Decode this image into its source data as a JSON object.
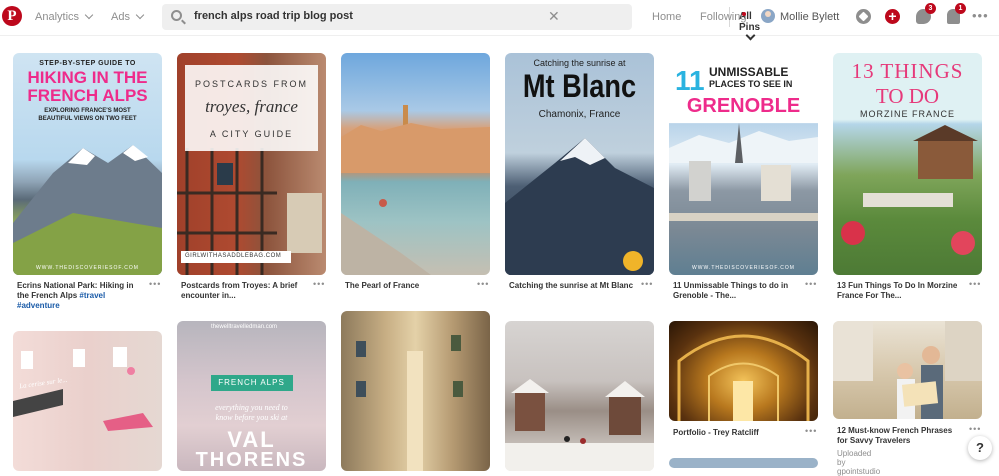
{
  "header": {
    "logo": "P",
    "analytics": "Analytics",
    "ads": "Ads",
    "search_value": "french alps road trip blog post",
    "clear": "✕",
    "scope": "All Pins",
    "home": "Home",
    "following": "Following",
    "user": "Mollie Bylett",
    "plus": "+",
    "chat_badge": "3",
    "bell_badge": "1",
    "more": "•••"
  },
  "pins": [
    {
      "caption": "Ecrins National Park: Hiking in the French Alps",
      "tags": "#travel #adventure",
      "lines": [
        "STEP-BY-STEP GUIDE TO",
        "HIKING IN THE",
        "FRENCH ALPS",
        "EXPLORING FRANCE'S MOST",
        "BEAUTIFUL VIEWS ON TWO FEET"
      ],
      "footer": "WWW.THEDISCOVERIESOF.COM"
    },
    {
      "caption": "Postcards from Troyes: A brief encounter in...",
      "lines": [
        "POSTCARDS FROM",
        "troyes, france",
        "A CITY GUIDE"
      ],
      "footer": "GIRLWITHASADDLEBAG.COM"
    },
    {
      "caption": "The Pearl of France"
    },
    {
      "caption": "Catching the sunrise at Mt Blanc",
      "lines": [
        "Catching the sunrise at",
        "Mt Blanc",
        "Chamonix, France"
      ]
    },
    {
      "caption": "11 Unmissable Things to do in Grenoble - The...",
      "lines": [
        "11",
        "UNMISSABLE",
        "PLACES TO SEE IN",
        "GRENOBLE"
      ],
      "footer": "WWW.THEDISCOVERIESOF.COM"
    },
    {
      "caption": "13 Fun Things To Do In Morzine France For The...",
      "lines": [
        "13 THINGS",
        "TO DO",
        "MORZINE FRANCE"
      ]
    },
    {
      "lines": [
        "La cerise sur le..."
      ]
    },
    {
      "lines": [
        "thewelltravelledman.com",
        "FRENCH ALPS",
        "everything you need to",
        "know before you ski at",
        "VAL",
        "THORENS"
      ]
    },
    {},
    {},
    {
      "caption": "Portfolio - Trey Ratcliff"
    },
    {
      "caption": "12 Must-know French Phrases for Savvy Travelers",
      "uploader_prefix": "Uploaded by",
      "uploader": "gpointstudio"
    }
  ],
  "help": "?"
}
